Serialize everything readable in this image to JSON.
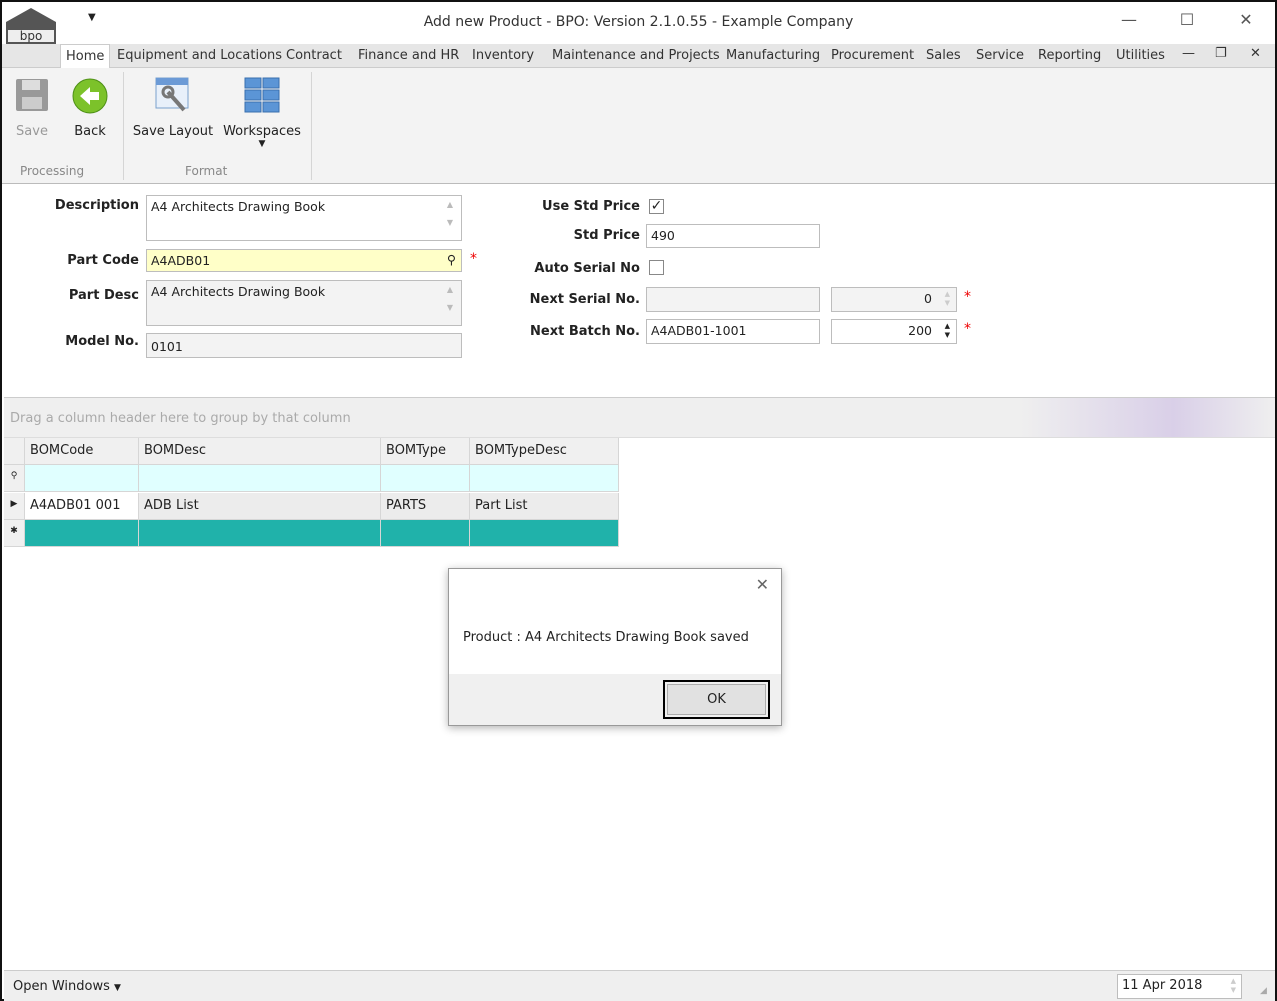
{
  "window": {
    "title": "Add new Product - BPO: Version 2.1.0.55 - Example Company",
    "logo_text": "bpo"
  },
  "tabs": [
    {
      "label": "Home"
    },
    {
      "label": "Equipment and Locations"
    },
    {
      "label": "Contract"
    },
    {
      "label": "Finance and HR"
    },
    {
      "label": "Inventory"
    },
    {
      "label": "Maintenance and Projects"
    },
    {
      "label": "Manufacturing"
    },
    {
      "label": "Procurement"
    },
    {
      "label": "Sales"
    },
    {
      "label": "Service"
    },
    {
      "label": "Reporting"
    },
    {
      "label": "Utilities"
    }
  ],
  "ribbon": {
    "save": "Save",
    "back": "Back",
    "save_layout": "Save Layout",
    "workspaces": "Workspaces",
    "group_processing": "Processing",
    "group_format": "Format"
  },
  "form": {
    "description_label": "Description",
    "description": "A4 Architects Drawing Book",
    "part_code_label": "Part Code",
    "part_code": "A4ADB01",
    "part_desc_label": "Part Desc",
    "part_desc": "A4 Architects Drawing Book",
    "model_no_label": "Model No.",
    "model_no": "0101",
    "use_std_price_label": "Use Std Price",
    "use_std_price": true,
    "std_price_label": "Std Price",
    "std_price": "490",
    "auto_serial_label": "Auto Serial No",
    "auto_serial": false,
    "next_serial_label": "Next Serial No.",
    "next_serial": "",
    "next_serial_count": "0",
    "next_batch_label": "Next Batch No.",
    "next_batch": "A4ADB01-1001",
    "next_batch_count": "200",
    "required_mark": "*"
  },
  "grid": {
    "group_hint": "Drag a column header here to group by that column",
    "columns": [
      "BOMCode",
      "BOMDesc",
      "BOMType",
      "BOMTypeDesc"
    ],
    "rows": [
      [
        "A4ADB01 001",
        "ADB List",
        "PARTS",
        "Part List"
      ]
    ],
    "new_row_color": "#20b2aa"
  },
  "dialog": {
    "message": "Product : A4 Architects Drawing Book saved",
    "ok": "OK"
  },
  "status": {
    "open_windows": "Open Windows",
    "date": "11 Apr 2018"
  }
}
